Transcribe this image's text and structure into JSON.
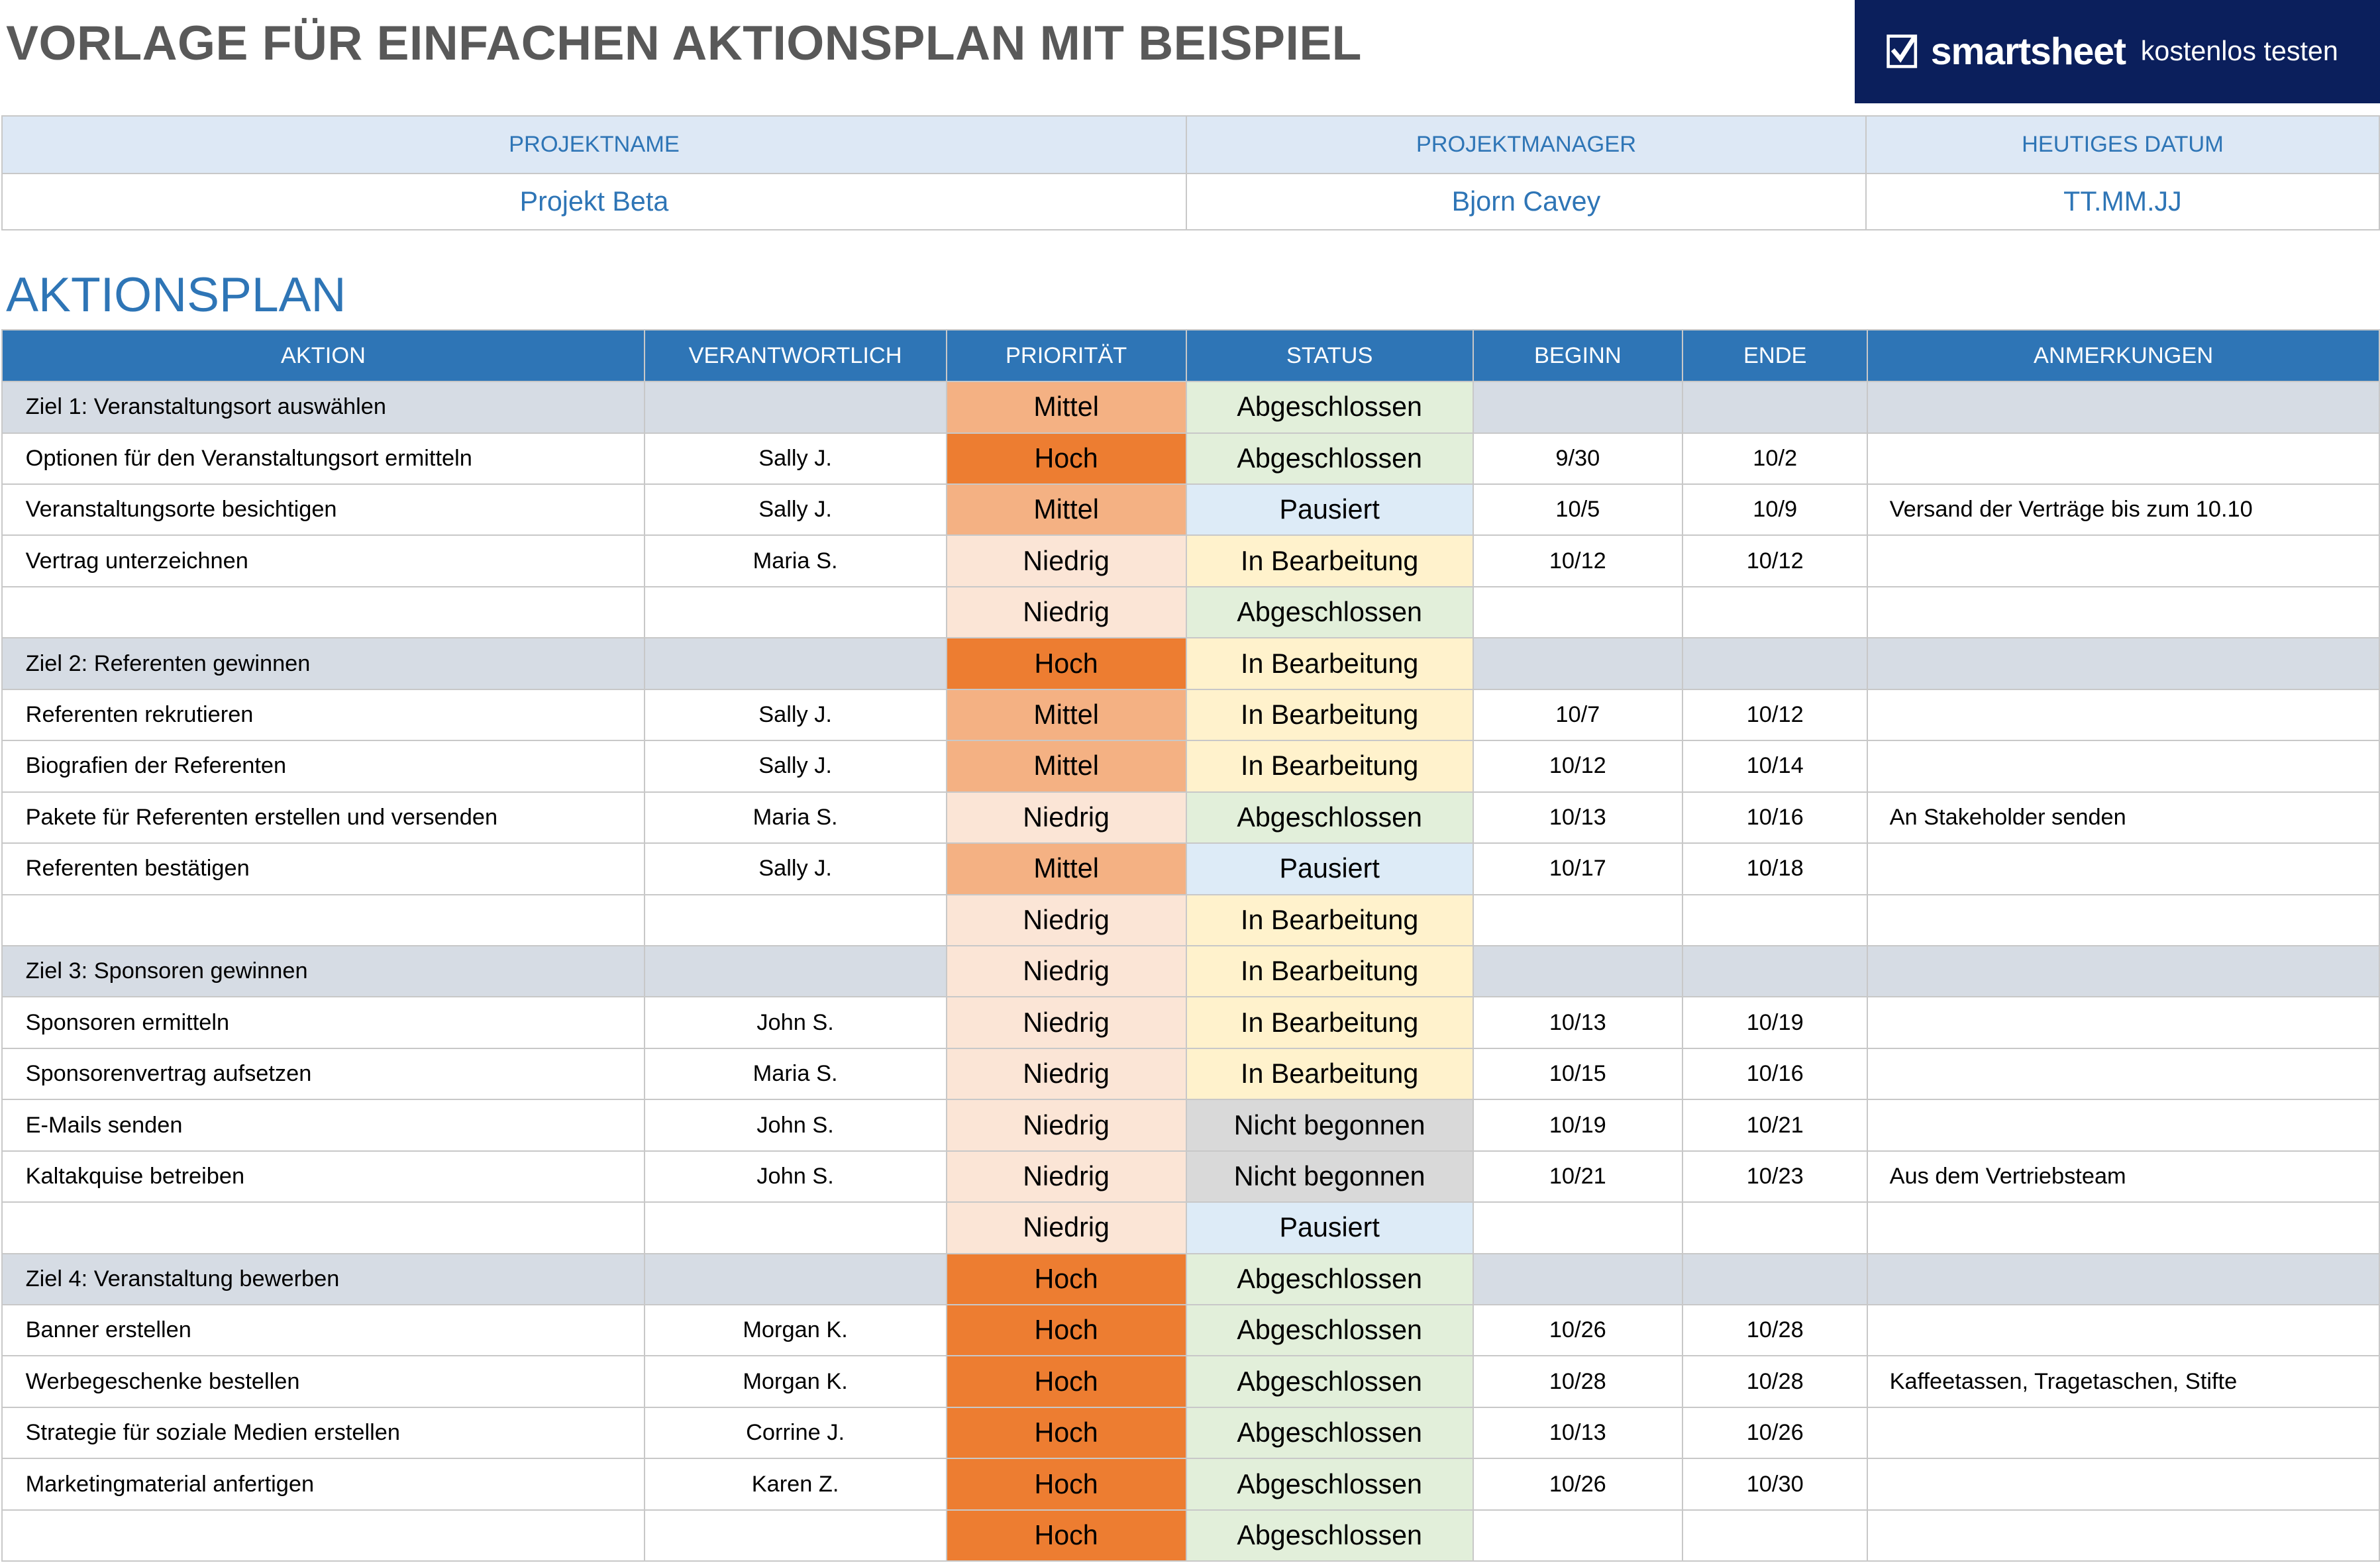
{
  "title": "VORLAGE FÜR EINFACHEN AKTIONSPLAN MIT BEISPIEL",
  "logo": {
    "brand": "smartsheet",
    "cta": "kostenlos testen",
    "icon": "smartsheet-check-icon"
  },
  "project": {
    "headers": [
      "PROJEKTNAME",
      "PROJEKTMANAGER",
      "HEUTIGES DATUM"
    ],
    "values": [
      "Projekt Beta",
      "Bjorn Cavey",
      "TT.MM.JJ"
    ]
  },
  "section_title": "AKTIONSPLAN",
  "columns": [
    "AKTION",
    "VERANTWORTLICH",
    "PRIORITÄT",
    "STATUS",
    "BEGINN",
    "ENDE",
    "ANMERKUNGEN"
  ],
  "colors": {
    "header_blue": "#2e75b6",
    "title_gray": "#595959",
    "goal_row": "#d6dce4",
    "priority": {
      "Hoch": "#ed7d31",
      "Mittel": "#f4b183",
      "Niedrig": "#fbe5d6"
    },
    "status": {
      "Abgeschlossen": "#e2efda",
      "Pausiert": "#ddebf7",
      "In Bearbeitung": "#fff2cc",
      "Nicht begonnen": "#d9d9d9"
    }
  },
  "rows": [
    {
      "goal": true,
      "action": "Ziel 1: Veranstaltungsort auswählen",
      "owner": "",
      "priority": "Mittel",
      "status": "Abgeschlossen",
      "start": "",
      "end": "",
      "notes": ""
    },
    {
      "action": "Optionen für den Veranstaltungsort ermitteln",
      "owner": "Sally J.",
      "priority": "Hoch",
      "status": "Abgeschlossen",
      "start": "9/30",
      "end": "10/2",
      "notes": ""
    },
    {
      "action": "Veranstaltungsorte besichtigen",
      "owner": "Sally J.",
      "priority": "Mittel",
      "status": "Pausiert",
      "start": "10/5",
      "end": "10/9",
      "notes": "Versand der Verträge bis zum 10.10"
    },
    {
      "action": "Vertrag unterzeichnen",
      "owner": "Maria S.",
      "priority": "Niedrig",
      "status": "In Bearbeitung",
      "start": "10/12",
      "end": "10/12",
      "notes": ""
    },
    {
      "action": "",
      "owner": "",
      "priority": "Niedrig",
      "status": "Abgeschlossen",
      "start": "",
      "end": "",
      "notes": ""
    },
    {
      "goal": true,
      "action": "Ziel 2: Referenten gewinnen",
      "owner": "",
      "priority": "Hoch",
      "status": "In Bearbeitung",
      "start": "",
      "end": "",
      "notes": ""
    },
    {
      "action": "Referenten rekrutieren",
      "owner": "Sally J.",
      "priority": "Mittel",
      "status": "In Bearbeitung",
      "start": "10/7",
      "end": "10/12",
      "notes": ""
    },
    {
      "action": "Biografien der Referenten",
      "owner": "Sally J.",
      "priority": "Mittel",
      "status": "In Bearbeitung",
      "start": "10/12",
      "end": "10/14",
      "notes": ""
    },
    {
      "action": "Pakete für Referenten erstellen und versenden",
      "owner": "Maria S.",
      "priority": "Niedrig",
      "status": "Abgeschlossen",
      "start": "10/13",
      "end": "10/16",
      "notes": "An Stakeholder senden"
    },
    {
      "action": "Referenten bestätigen",
      "owner": "Sally J.",
      "priority": "Mittel",
      "status": "Pausiert",
      "start": "10/17",
      "end": "10/18",
      "notes": ""
    },
    {
      "action": "",
      "owner": "",
      "priority": "Niedrig",
      "status": "In Bearbeitung",
      "start": "",
      "end": "",
      "notes": ""
    },
    {
      "goal": true,
      "action": "Ziel 3: Sponsoren gewinnen",
      "owner": "",
      "priority": "Niedrig",
      "status": "In Bearbeitung",
      "start": "",
      "end": "",
      "notes": ""
    },
    {
      "action": "Sponsoren ermitteln",
      "owner": "John S.",
      "priority": "Niedrig",
      "status": "In Bearbeitung",
      "start": "10/13",
      "end": "10/19",
      "notes": ""
    },
    {
      "action": "Sponsorenvertrag aufsetzen",
      "owner": "Maria S.",
      "priority": "Niedrig",
      "status": "In Bearbeitung",
      "start": "10/15",
      "end": "10/16",
      "notes": ""
    },
    {
      "action": "E-Mails senden",
      "owner": "John S.",
      "priority": "Niedrig",
      "status": "Nicht begonnen",
      "start": "10/19",
      "end": "10/21",
      "notes": ""
    },
    {
      "action": "Kaltakquise betreiben",
      "owner": "John S.",
      "priority": "Niedrig",
      "status": "Nicht begonnen",
      "start": "10/21",
      "end": "10/23",
      "notes": "Aus dem Vertriebsteam"
    },
    {
      "action": "",
      "owner": "",
      "priority": "Niedrig",
      "status": "Pausiert",
      "start": "",
      "end": "",
      "notes": ""
    },
    {
      "goal": true,
      "action": "Ziel 4: Veranstaltung bewerben",
      "owner": "",
      "priority": "Hoch",
      "status": "Abgeschlossen",
      "start": "",
      "end": "",
      "notes": ""
    },
    {
      "action": "Banner erstellen",
      "owner": "Morgan K.",
      "priority": "Hoch",
      "status": "Abgeschlossen",
      "start": "10/26",
      "end": "10/28",
      "notes": ""
    },
    {
      "action": "Werbegeschenke bestellen",
      "owner": "Morgan K.",
      "priority": "Hoch",
      "status": "Abgeschlossen",
      "start": "10/28",
      "end": "10/28",
      "notes": "Kaffeetassen, Tragetaschen, Stifte"
    },
    {
      "action": "Strategie für soziale Medien erstellen",
      "owner": "Corrine J.",
      "priority": "Hoch",
      "status": "Abgeschlossen",
      "start": "10/13",
      "end": "10/26",
      "notes": ""
    },
    {
      "action": "Marketingmaterial anfertigen",
      "owner": "Karen Z.",
      "priority": "Hoch",
      "status": "Abgeschlossen",
      "start": "10/26",
      "end": "10/30",
      "notes": ""
    },
    {
      "action": "",
      "owner": "",
      "priority": "Hoch",
      "status": "Abgeschlossen",
      "start": "",
      "end": "",
      "notes": ""
    }
  ]
}
